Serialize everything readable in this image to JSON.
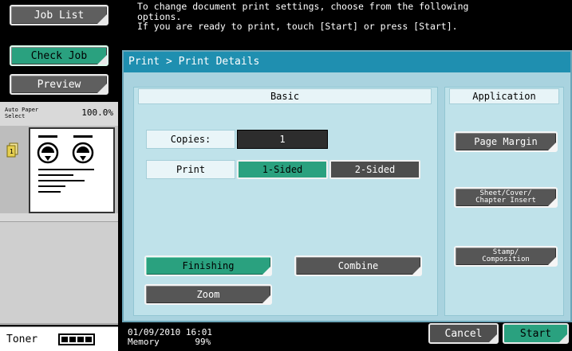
{
  "sidebar": {
    "job_list": "Job List",
    "check_job": "Check Job",
    "preview": "Preview",
    "paper_select_line1": "Auto Paper",
    "paper_select_line2": "Select",
    "zoom_value": "100.0%",
    "toner_label": "Toner",
    "toner_level": 4
  },
  "message": {
    "line1": "To change document print settings, choose from the following",
    "line2": "options.",
    "line3": "If you are ready to print, touch [Start] or press [Start]."
  },
  "main": {
    "breadcrumb": "Print > Print Details",
    "basic_header": "Basic",
    "application_header": "Application",
    "copies_label": "Copies:",
    "copies_value": "1",
    "print_label": "Print",
    "one_sided": "1-Sided",
    "two_sided": "2-Sided",
    "selected_sides": "1-Sided",
    "finishing": "Finishing",
    "combine": "Combine",
    "zoom": "Zoom",
    "page_margin": "Page Margin",
    "sheet_cover_line1": "Sheet/Cover/",
    "sheet_cover_line2": "Chapter Insert",
    "stamp_line1": "Stamp/",
    "stamp_line2": "Composition"
  },
  "status": {
    "datetime": "01/09/2010   16:01",
    "memory_label": "Memory",
    "memory_value": "99%"
  },
  "actions": {
    "cancel": "Cancel",
    "start": "Start"
  },
  "colors": {
    "accent_green": "#2aa17f",
    "title_blue": "#1f8fb0",
    "panel_bg": "#a9d3df"
  }
}
